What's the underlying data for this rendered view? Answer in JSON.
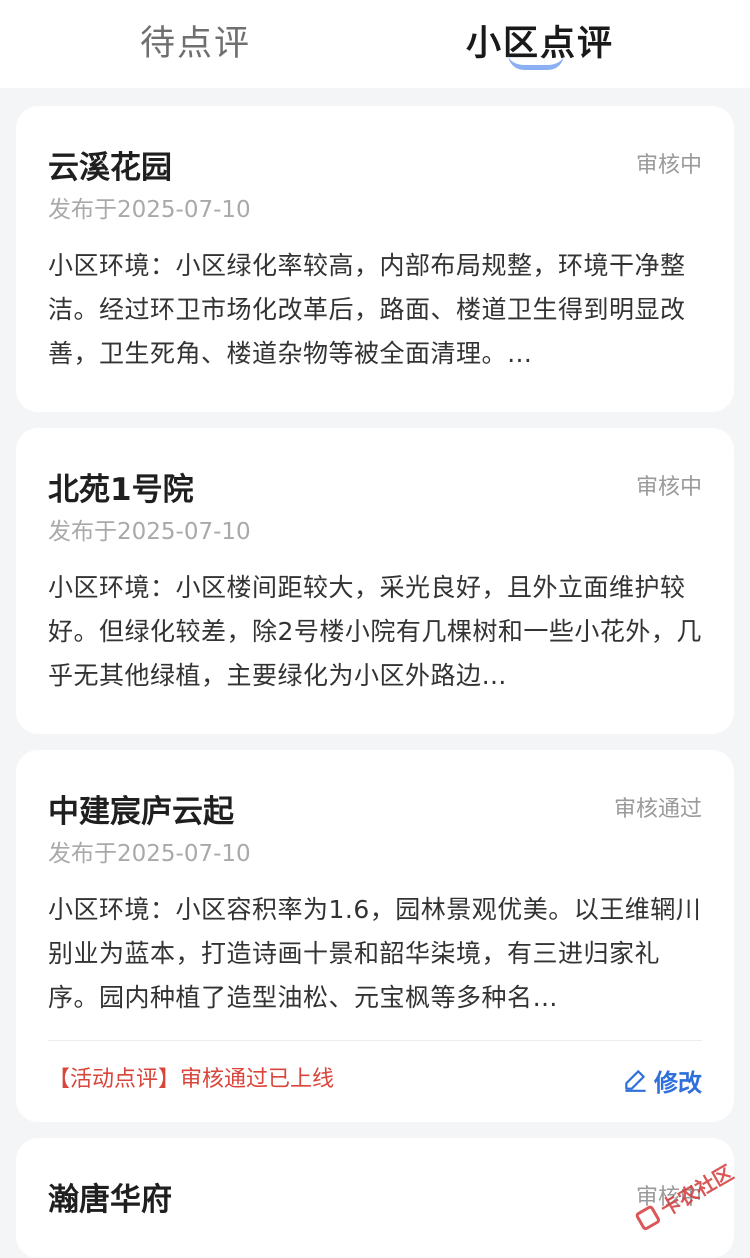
{
  "tabs": [
    {
      "label": "待点评",
      "active": false
    },
    {
      "label": "小区点评",
      "active": true
    }
  ],
  "reviews": [
    {
      "title": "云溪花园",
      "status": "审核中",
      "date": "发布于2025-07-10",
      "body": "小区环境：小区绿化率较高，内部布局规整，环境干净整洁。经过环卫市场化改革后，路面、楼道卫生得到明显改善，卫生死角、楼道杂物等被全面清理。…"
    },
    {
      "title": "北苑1号院",
      "status": "审核中",
      "date": "发布于2025-07-10",
      "body": "小区环境：小区楼间距较大，采光良好，且外立面维护较好。但绿化较差，除2号楼小院有几棵树和一些小花外，几乎无其他绿植，主要绿化为小区外路边…"
    },
    {
      "title": "中建宸庐云起",
      "status": "审核通过",
      "date": "发布于2025-07-10",
      "body": "小区环境：小区容积率为1.6，园林景观优美。以王维辋川别业为蓝本，打造诗画十景和韶华柒境，有三进归家礼序。园内种植了造型油松、元宝枫等多种名…",
      "activity": "【活动点评】审核通过已上线",
      "edit_label": "修改"
    },
    {
      "title": "瀚唐华府",
      "status": "审核中"
    }
  ],
  "watermark": "卡农社区",
  "colors": {
    "accent_blue": "#2f6fd9",
    "status_red": "#d9453b",
    "background": "#f4f5f7"
  }
}
